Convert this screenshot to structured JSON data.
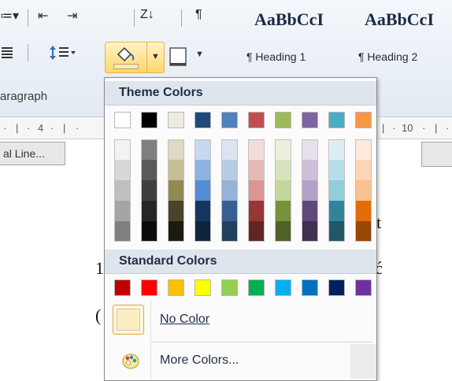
{
  "ribbon": {
    "top_row": [
      "≔▾",
      "⇤",
      "⇥",
      "Z↓",
      "¶"
    ],
    "styles": [
      {
        "preview": "AaBbCcI",
        "label": "¶ Heading 1"
      },
      {
        "preview": "AaBbCcI",
        "label": "¶ Heading 2"
      }
    ],
    "paragraph_group_label": "aragraph",
    "line_spacing_icon": "line-spacing-icon",
    "shading_icon": "paint-bucket-icon",
    "border_icon": "border-icon",
    "ruler_marks": [
      "·",
      "|",
      "·",
      "4",
      "·",
      "|",
      "·",
      "|",
      "·",
      "10",
      "·",
      "|",
      "·"
    ]
  },
  "document": {
    "button_text": "al Line...",
    "fragments": [
      "t",
      "1",
      "ć",
      "("
    ]
  },
  "dropdown": {
    "theme_header": "Theme Colors",
    "standard_header": "Standard Colors",
    "no_color_label": "No Color",
    "more_colors_label": "More Colors...",
    "theme_base": [
      "#ffffff",
      "#000000",
      "#eeece1",
      "#1f497d",
      "#4f81bd",
      "#c0504d",
      "#9bbb59",
      "#8064a2",
      "#4bacc6",
      "#f79646"
    ],
    "theme_tints": [
      [
        "#f2f2f2",
        "#d8d8d8",
        "#bfbfbf",
        "#a5a5a5",
        "#7f7f7f"
      ],
      [
        "#7f7f7f",
        "#595959",
        "#3f3f3f",
        "#262626",
        "#0c0c0c"
      ],
      [
        "#ddd9c3",
        "#c4bd97",
        "#938953",
        "#494429",
        "#1d1b10"
      ],
      [
        "#c6d9f0",
        "#8db3e2",
        "#548dd4",
        "#17365d",
        "#0f243e"
      ],
      [
        "#dbe5f1",
        "#b8cce4",
        "#95b3d7",
        "#366092",
        "#244061"
      ],
      [
        "#f2dcdb",
        "#e5b9b7",
        "#d99694",
        "#953734",
        "#632423"
      ],
      [
        "#ebf1dd",
        "#d7e3bc",
        "#c3d69b",
        "#76923c",
        "#4f6128"
      ],
      [
        "#e5e0ec",
        "#ccc1d9",
        "#b2a2c7",
        "#5f497a",
        "#3f3151"
      ],
      [
        "#dbeef3",
        "#b7dde8",
        "#92cddc",
        "#31859b",
        "#205867"
      ],
      [
        "#fdeada",
        "#fbd5b5",
        "#fac08f",
        "#e36c09",
        "#974806"
      ]
    ],
    "standard": [
      "#c00000",
      "#ff0000",
      "#ffc000",
      "#ffff00",
      "#92d050",
      "#00b050",
      "#00b0f0",
      "#0070c0",
      "#002060",
      "#7030a0"
    ],
    "no_color_swatch": "#fbeec2"
  }
}
